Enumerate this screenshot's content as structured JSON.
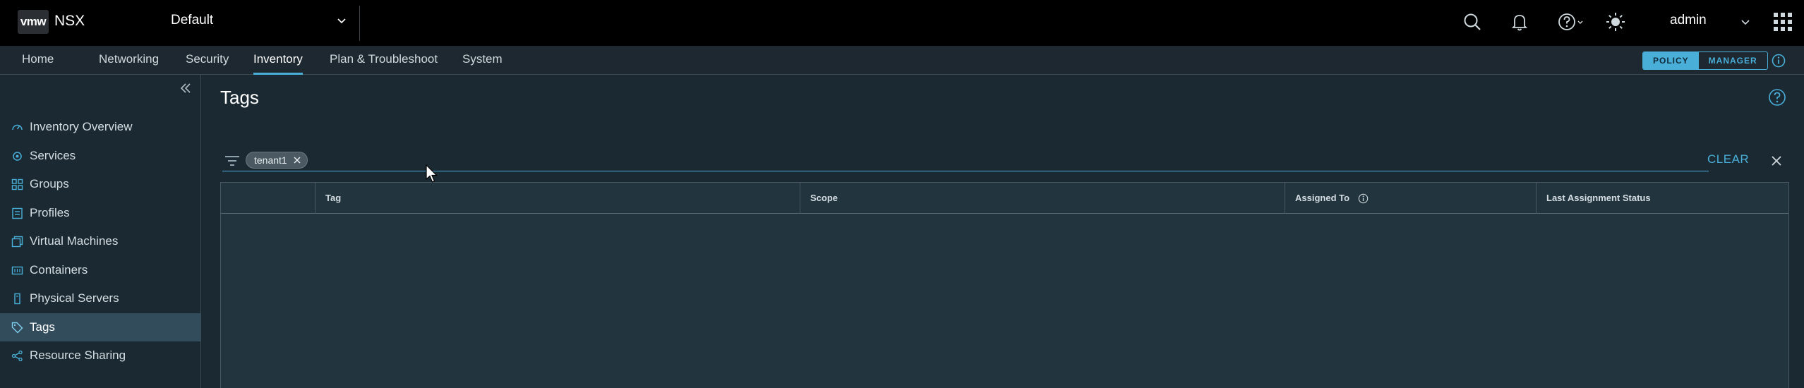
{
  "header": {
    "logo_text": "vmw",
    "app_name": "NSX",
    "project": "Default",
    "user": "admin"
  },
  "nav": {
    "tabs": [
      "Home",
      "Networking",
      "Security",
      "Inventory",
      "Plan & Troubleshoot",
      "System"
    ],
    "active_tab": "Inventory",
    "mode_policy": "POLICY",
    "mode_manager": "MANAGER"
  },
  "sidebar": {
    "items": [
      {
        "label": "Inventory Overview",
        "icon": "dashboard-icon"
      },
      {
        "label": "Services",
        "icon": "services-icon"
      },
      {
        "label": "Groups",
        "icon": "groups-icon"
      },
      {
        "label": "Profiles",
        "icon": "profile-icon"
      },
      {
        "label": "Virtual Machines",
        "icon": "vm-icon"
      },
      {
        "label": "Containers",
        "icon": "container-icon"
      },
      {
        "label": "Physical Servers",
        "icon": "server-icon"
      },
      {
        "label": "Tags",
        "icon": "tag-icon"
      },
      {
        "label": "Resource Sharing",
        "icon": "share-icon"
      }
    ],
    "active_item": "Tags"
  },
  "main": {
    "title": "Tags",
    "filter_chip": "tenant1",
    "clear_label": "CLEAR",
    "columns": [
      "Tag",
      "Scope",
      "Assigned To",
      "Last Assignment Status"
    ]
  },
  "colors": {
    "accent": "#49afd9",
    "header_bg": "#000000",
    "page_bg": "#1b2a32",
    "grid_bg": "#22343e",
    "selected_bg": "#324c5b"
  }
}
